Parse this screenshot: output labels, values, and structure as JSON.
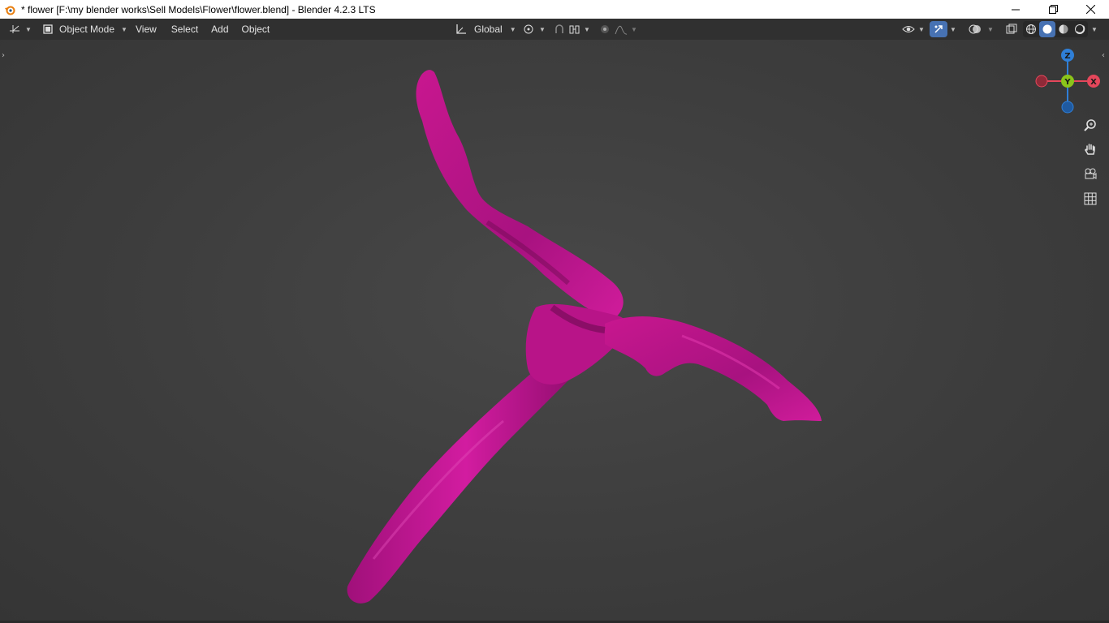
{
  "titlebar": {
    "title": "* flower [F:\\my blender works\\Sell Models\\Flower\\flower.blend] - Blender 4.2.3 LTS",
    "app_icon": "blender-logo-icon",
    "buttons": [
      "minimize-icon",
      "restore-icon",
      "close-icon"
    ]
  },
  "header": {
    "editor_type_icon": "3d-viewport-icon",
    "mode": "Object Mode",
    "menus": [
      "View",
      "Select",
      "Add",
      "Object"
    ],
    "transform_orientation": "Global",
    "pivot_icon": "pivot-point-icon",
    "snap_icon": "snap-icon",
    "snap_target_icon": "snap-increment-icon",
    "proportional_icon": "proportional-edit-icon",
    "falloff_icon": "falloff-curve-icon",
    "right_icons": [
      "visibility-icon",
      "gizmo-icon",
      "overlay-icon",
      "xray-icon",
      "wireframe-shading-icon",
      "solid-shading-icon",
      "material-shading-icon",
      "rendered-shading-icon"
    ]
  },
  "gizmo": {
    "x_label": "X",
    "y_label": "Y",
    "z_label": "Z",
    "colors": {
      "x": "#e5475b",
      "y": "#8bc41a",
      "z": "#2f7fd7"
    }
  },
  "nav_controls": [
    "zoom-icon",
    "pan-hand-icon",
    "camera-view-icon",
    "grid-ortho-icon"
  ],
  "viewport": {
    "object_color": "#c2168f",
    "background": "#3d3d3d"
  }
}
